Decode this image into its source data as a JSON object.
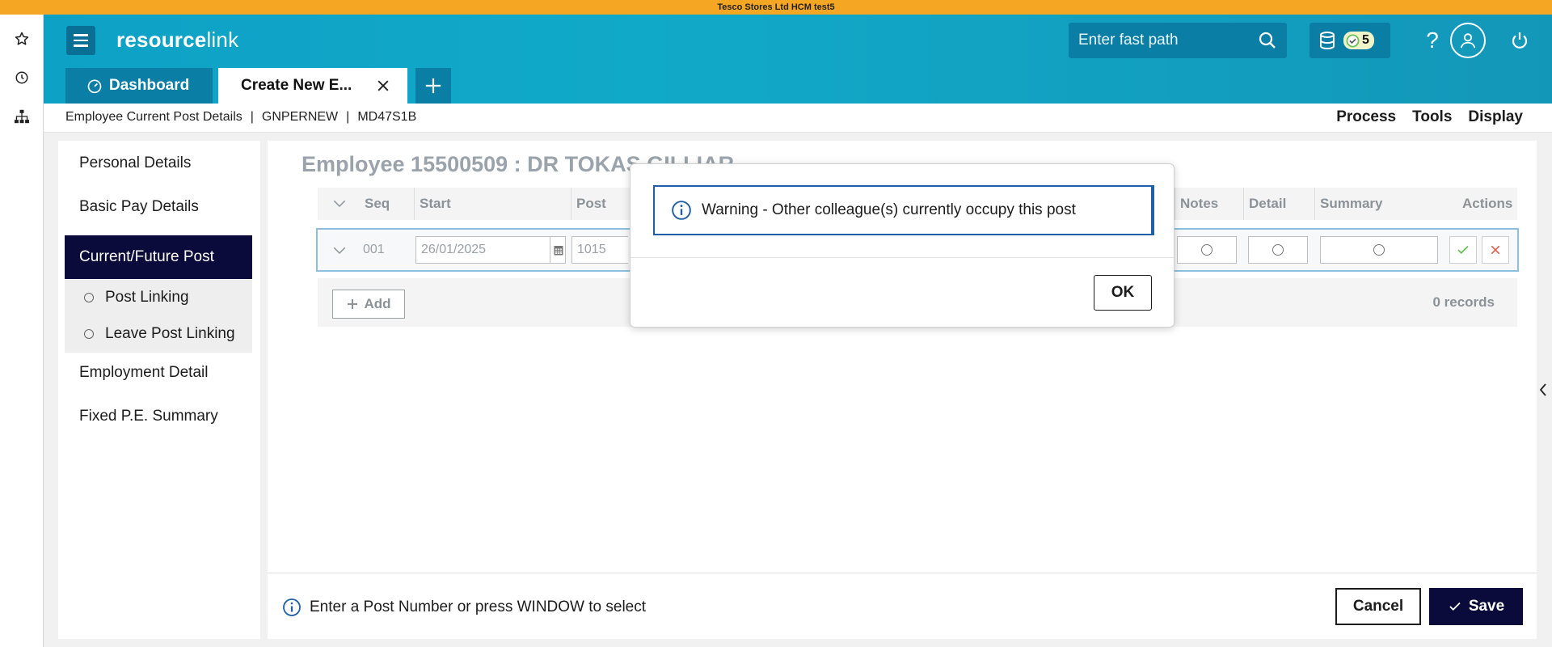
{
  "env": {
    "title": "Tesco Stores Ltd HCM test5"
  },
  "app": {
    "logo_bold": "resource",
    "logo_light": "link"
  },
  "header": {
    "fastpath_placeholder": "Enter fast path",
    "notification_count": "5",
    "help_label": "?"
  },
  "tabs": [
    {
      "label": "Dashboard"
    },
    {
      "label": "Create New E..."
    }
  ],
  "breadcrumb": {
    "page": "Employee Current Post Details",
    "code1": "GNPERNEW",
    "code2": "MD47S1B",
    "separator": "|"
  },
  "menu": {
    "process": "Process",
    "tools": "Tools",
    "display": "Display"
  },
  "nav": {
    "items": [
      "Personal Details",
      "Basic Pay Details",
      "Current/Future Post",
      "Employment Detail",
      "Fixed P.E. Summary"
    ],
    "sub_items": [
      "Post Linking",
      "Leave Post Linking"
    ]
  },
  "main": {
    "title": "Employee 15500509 : DR TOKAS GILLIAR",
    "columns": [
      "Seq",
      "Start",
      "Post",
      "Notes",
      "Detail",
      "Summary",
      "Actions"
    ],
    "row": {
      "seq": "001",
      "start": "26/01/2025",
      "post": "1015"
    },
    "add_label": "Add",
    "records": "0 records",
    "hint": "Enter a Post Number or press WINDOW to select",
    "cancel": "Cancel",
    "save": "Save"
  },
  "modal": {
    "message": "Warning - Other colleague(s) currently occupy this post",
    "ok": "OK"
  },
  "colors": {
    "header": "#11a9c8",
    "header_dark": "#0b7ea6",
    "env_bar": "#f5a623",
    "nav_active": "#0b0b3b",
    "info_blue": "#1e5fa5",
    "accept_green": "#6bbf59",
    "delete_red": "#e05a4e"
  },
  "icons": {
    "rail": [
      "star-icon",
      "clock-icon",
      "sitemap-icon"
    ],
    "header": [
      "menu-icon",
      "search-icon",
      "database-icon",
      "check-circle-icon",
      "help-icon",
      "user-icon",
      "power-icon"
    ],
    "row": [
      "chevron-down-icon",
      "calendar-icon",
      "check-icon",
      "close-icon"
    ]
  }
}
